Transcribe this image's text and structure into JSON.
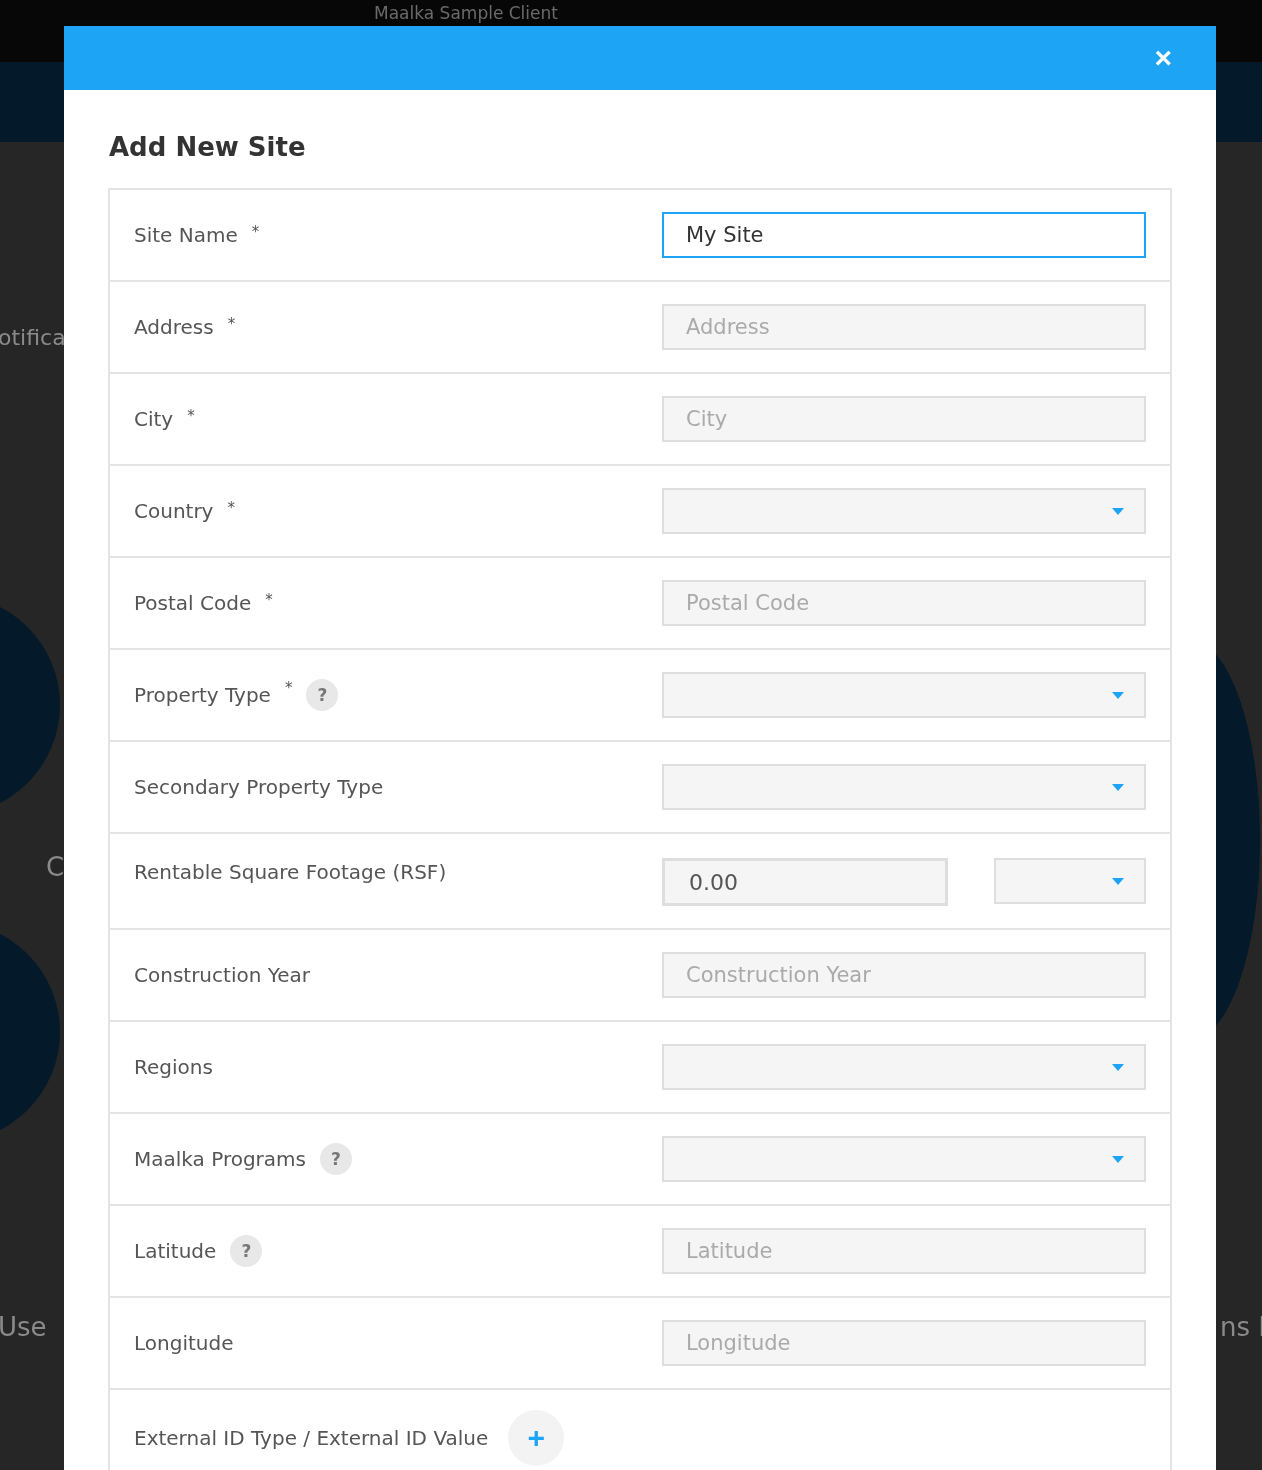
{
  "background": {
    "client_name": "Maalka Sample Client",
    "fragments": [
      "otifica",
      "C",
      "Use",
      "ns I"
    ]
  },
  "modal": {
    "close": "×",
    "title": "Add New Site",
    "rows": [
      {
        "kind": "text",
        "label": "Site Name",
        "required": true,
        "help": false,
        "value": "My Site",
        "focused": true
      },
      {
        "kind": "text",
        "label": "Address",
        "required": true,
        "help": false,
        "placeholder": "Address",
        "focused": false
      },
      {
        "kind": "text",
        "label": "City",
        "required": true,
        "help": false,
        "placeholder": "City",
        "focused": false
      },
      {
        "kind": "select",
        "label": "Country",
        "required": true,
        "help": false
      },
      {
        "kind": "text",
        "label": "Postal Code",
        "required": true,
        "help": false,
        "placeholder": "Postal Code",
        "focused": false
      },
      {
        "kind": "select",
        "label": "Property Type",
        "required": true,
        "help": true
      },
      {
        "kind": "select",
        "label": "Secondary Property Type",
        "required": false,
        "help": false
      },
      {
        "kind": "area",
        "label": "Rentable Square Footage (RSF)",
        "required": false,
        "help": false,
        "value": "0.00"
      },
      {
        "kind": "text",
        "label": "Construction Year",
        "required": false,
        "help": false,
        "placeholder": "Construction Year",
        "focused": false
      },
      {
        "kind": "select",
        "label": "Regions",
        "required": false,
        "help": false
      },
      {
        "kind": "select",
        "label": "Maalka Programs",
        "required": false,
        "help": true
      },
      {
        "kind": "text",
        "label": "Latitude",
        "required": false,
        "help": true,
        "placeholder": "Latitude",
        "focused": false
      },
      {
        "kind": "text",
        "label": "Longitude",
        "required": false,
        "help": false,
        "placeholder": "Longitude",
        "focused": false
      },
      {
        "kind": "add",
        "label": "External ID Type / External ID Value",
        "required": false,
        "help": false,
        "add": "+"
      }
    ],
    "required_mark": "*",
    "help_mark": "?"
  }
}
